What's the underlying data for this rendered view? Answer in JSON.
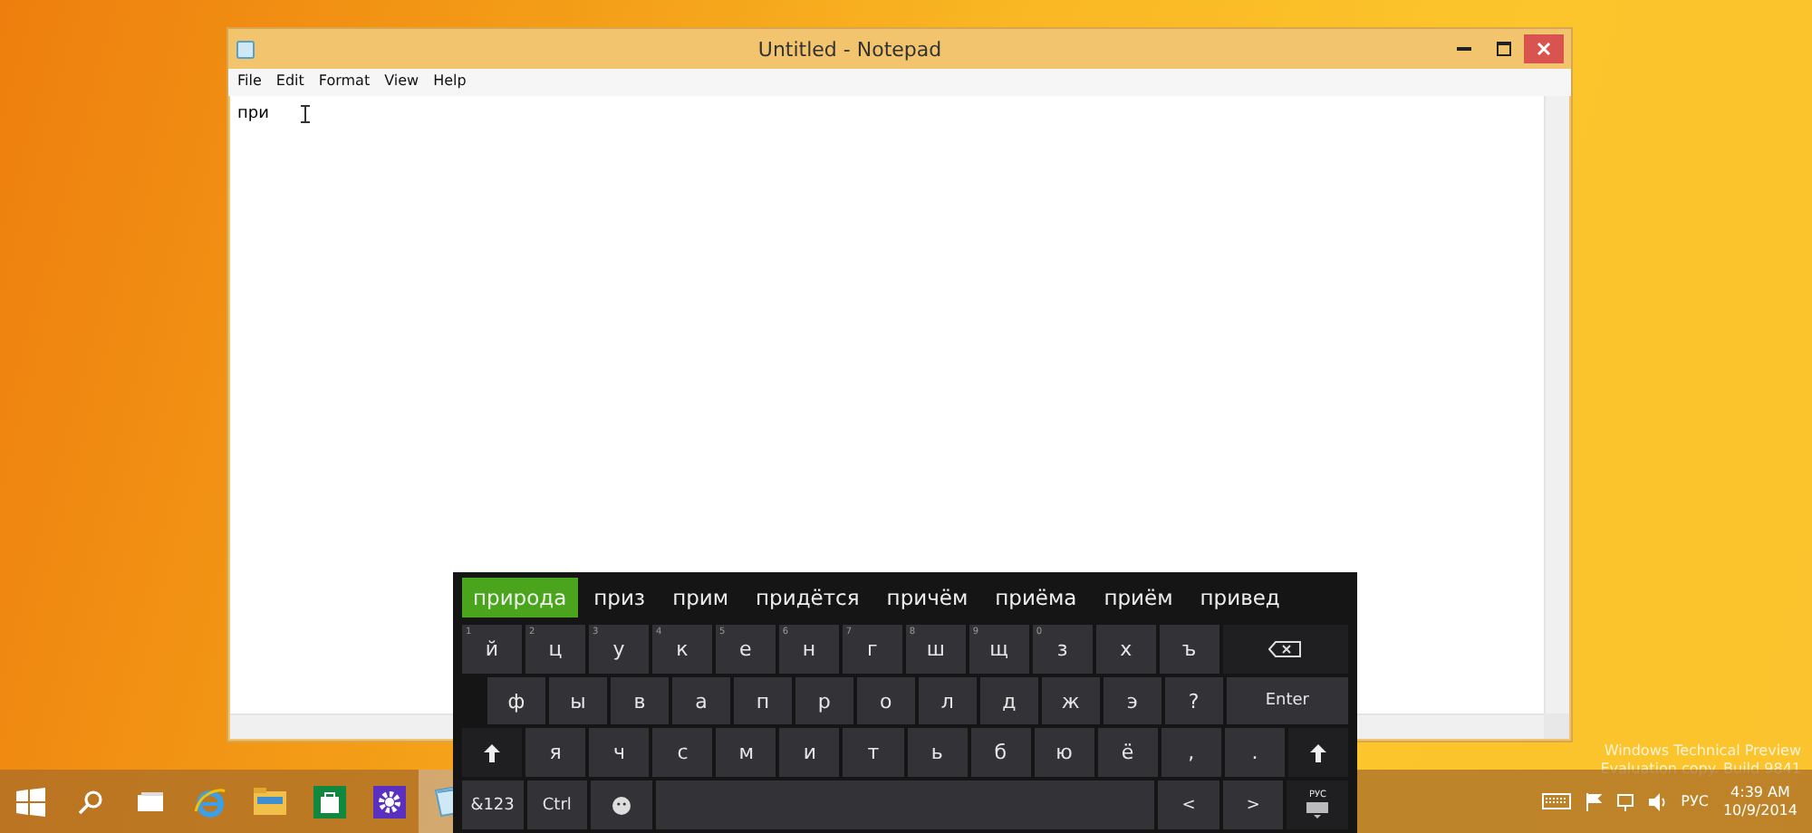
{
  "notepad": {
    "title": "Untitled - Notepad",
    "menu": [
      "File",
      "Edit",
      "Format",
      "View",
      "Help"
    ],
    "text": "при"
  },
  "keyboard": {
    "suggestions": [
      {
        "label": "природа",
        "selected": true
      },
      {
        "label": "приз",
        "selected": false
      },
      {
        "label": "прим",
        "selected": false
      },
      {
        "label": "придётся",
        "selected": false
      },
      {
        "label": "причём",
        "selected": false
      },
      {
        "label": "приёма",
        "selected": false
      },
      {
        "label": "приём",
        "selected": false
      },
      {
        "label": "привед",
        "selected": false
      }
    ],
    "key_rows": [
      {
        "indented": false,
        "keys": [
          {
            "kind": "letter",
            "label": "й",
            "hint": "1"
          },
          {
            "kind": "letter",
            "label": "ц",
            "hint": "2"
          },
          {
            "kind": "letter",
            "label": "у",
            "hint": "3"
          },
          {
            "kind": "letter",
            "label": "к",
            "hint": "4"
          },
          {
            "kind": "letter",
            "label": "е",
            "hint": "5"
          },
          {
            "kind": "letter",
            "label": "н",
            "hint": "6"
          },
          {
            "kind": "letter",
            "label": "г",
            "hint": "7"
          },
          {
            "kind": "letter",
            "label": "ш",
            "hint": "8"
          },
          {
            "kind": "letter",
            "label": "щ",
            "hint": "9"
          },
          {
            "kind": "letter",
            "label": "з",
            "hint": "0"
          },
          {
            "kind": "letter",
            "label": "х"
          },
          {
            "kind": "letter",
            "label": "ъ"
          },
          {
            "kind": "backspace"
          }
        ]
      },
      {
        "indented": true,
        "keys": [
          {
            "kind": "letter",
            "label": "ф"
          },
          {
            "kind": "letter",
            "label": "ы"
          },
          {
            "kind": "letter",
            "label": "в"
          },
          {
            "kind": "letter",
            "label": "а"
          },
          {
            "kind": "letter",
            "label": "п"
          },
          {
            "kind": "letter",
            "label": "р"
          },
          {
            "kind": "letter",
            "label": "о"
          },
          {
            "kind": "letter",
            "label": "л"
          },
          {
            "kind": "letter",
            "label": "д"
          },
          {
            "kind": "letter",
            "label": "ж"
          },
          {
            "kind": "letter",
            "label": "э"
          },
          {
            "kind": "letter",
            "label": "?"
          },
          {
            "kind": "wide",
            "label": "Enter"
          }
        ]
      },
      {
        "indented": false,
        "keys": [
          {
            "kind": "shift"
          },
          {
            "kind": "letter",
            "label": "я"
          },
          {
            "kind": "letter",
            "label": "ч"
          },
          {
            "kind": "letter",
            "label": "с"
          },
          {
            "kind": "letter",
            "label": "м"
          },
          {
            "kind": "letter",
            "label": "и"
          },
          {
            "kind": "letter",
            "label": "т"
          },
          {
            "kind": "letter",
            "label": "ь"
          },
          {
            "kind": "letter",
            "label": "б"
          },
          {
            "kind": "letter",
            "label": "ю"
          },
          {
            "kind": "letter",
            "label": "ё"
          },
          {
            "kind": "letter",
            "label": ","
          },
          {
            "kind": "letter",
            "label": "."
          },
          {
            "kind": "shift"
          }
        ]
      },
      {
        "indented": false,
        "keys": [
          {
            "kind": "special",
            "label": "&123"
          },
          {
            "kind": "special",
            "label": "Ctrl"
          },
          {
            "kind": "emoji"
          },
          {
            "kind": "space"
          },
          {
            "kind": "special",
            "label": "<"
          },
          {
            "kind": "special",
            "label": ">"
          },
          {
            "kind": "layout",
            "label": "РУС"
          }
        ]
      }
    ]
  },
  "desktop": {
    "watermark": [
      "Windows Technical Preview",
      "Evaluation copy. Build 9841"
    ]
  },
  "taskbar": {
    "apps": [
      {
        "kind": "start",
        "selected": false
      },
      {
        "kind": "search",
        "selected": false
      },
      {
        "kind": "task-view",
        "selected": false
      },
      {
        "kind": "browser",
        "selected": false
      },
      {
        "kind": "explorer",
        "selected": false
      },
      {
        "kind": "store",
        "selected": false
      },
      {
        "kind": "settings",
        "selected": false
      },
      {
        "kind": "notepad",
        "selected": true
      }
    ],
    "language": "РУС",
    "time": "4:39 AM",
    "date": "10/9/2014"
  }
}
